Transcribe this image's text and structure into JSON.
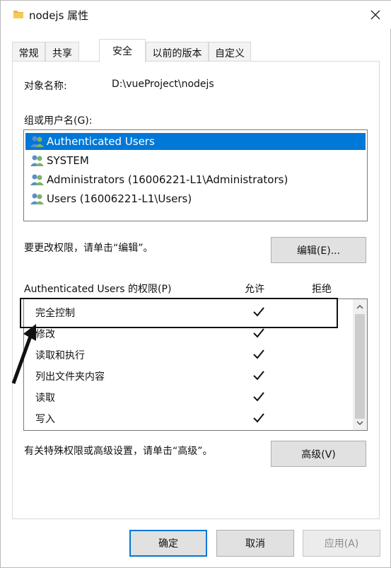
{
  "window": {
    "title": "nodejs 属性",
    "close_icon": "close-icon",
    "folder_icon": "folder-icon"
  },
  "tabs": [
    {
      "label": "常规",
      "active": false
    },
    {
      "label": "共享",
      "active": false
    },
    {
      "label": "安全",
      "active": true
    },
    {
      "label": "以前的版本",
      "active": false
    },
    {
      "label": "自定义",
      "active": false
    }
  ],
  "object_name": {
    "label": "对象名称:",
    "value": "D:\\vueProject\\nodejs"
  },
  "groups": {
    "label": "组或用户名(G):",
    "items": [
      {
        "name": "Authenticated Users",
        "selected": true
      },
      {
        "name": "SYSTEM",
        "selected": false
      },
      {
        "name": "Administrators (16006221-L1\\Administrators)",
        "selected": false
      },
      {
        "name": "Users (16006221-L1\\Users)",
        "selected": false
      }
    ]
  },
  "edit_hint": "要更改权限，请单击“编辑”。",
  "edit_button": "编辑(E)...",
  "permissions": {
    "header": "Authenticated Users 的权限(P)",
    "allow_col": "允许",
    "deny_col": "拒绝",
    "rows": [
      {
        "name": "完全控制",
        "allow": true,
        "deny": false
      },
      {
        "name": "修改",
        "allow": true,
        "deny": false
      },
      {
        "name": "读取和执行",
        "allow": true,
        "deny": false
      },
      {
        "name": "列出文件夹内容",
        "allow": true,
        "deny": false
      },
      {
        "name": "读取",
        "allow": true,
        "deny": false
      },
      {
        "name": "写入",
        "allow": true,
        "deny": false
      }
    ]
  },
  "advanced_hint": "有关特殊权限或高级设置，请单击“高级”。",
  "advanced_button": "高级(V)",
  "footer": {
    "ok": "确定",
    "cancel": "取消",
    "apply": "应用(A)"
  },
  "colors": {
    "selection": "#0078d7",
    "button_bg": "#e1e1e1",
    "primary_border": "#0078d7"
  }
}
